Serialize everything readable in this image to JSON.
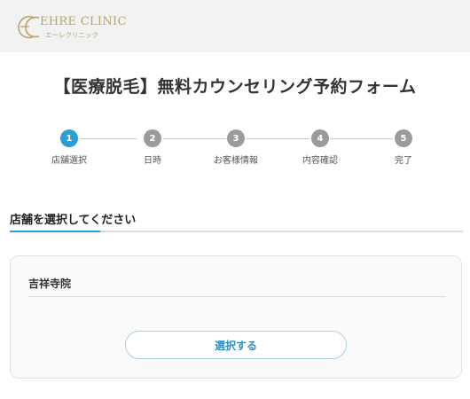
{
  "header": {
    "logo_name": "EHRE CLINIC",
    "logo_sub": "エーレクリニック",
    "brand_color": "#b9a46a"
  },
  "page_title": "【医療脱毛】無料カウンセリング予約フォーム",
  "steps": [
    {
      "number": "1",
      "label": "店舗選択",
      "active": true
    },
    {
      "number": "2",
      "label": "日時",
      "active": false
    },
    {
      "number": "3",
      "label": "お客様情報",
      "active": false
    },
    {
      "number": "4",
      "label": "内容確認",
      "active": false
    },
    {
      "number": "5",
      "label": "完了",
      "active": false
    }
  ],
  "section": {
    "heading": "店舗を選択してください"
  },
  "store_card": {
    "name": "吉祥寺院",
    "button_label": "選択する"
  },
  "colors": {
    "accent": "#2a9fd6",
    "inactive_step": "#9b9b9b",
    "header_bg": "#f2f2f2"
  }
}
